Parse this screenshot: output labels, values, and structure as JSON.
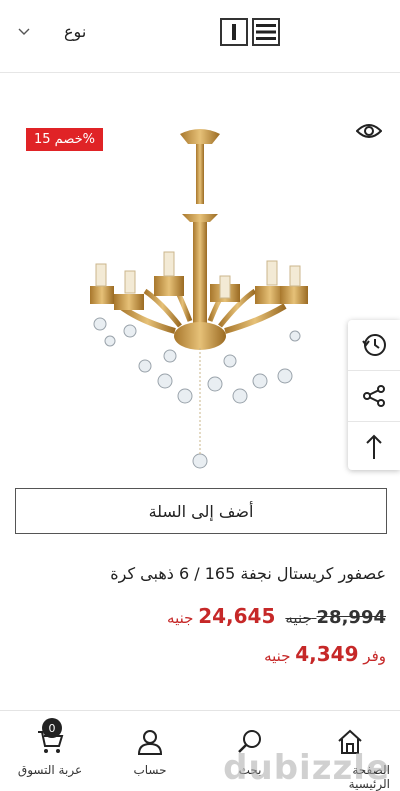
{
  "toolbar": {
    "sort_label": "نوع",
    "chevron_icon": "chevron-down-icon",
    "grid_icon": "grid-view-icon",
    "list_icon": "list-view-icon"
  },
  "product": {
    "discount_badge": "خصم 15%",
    "title": "عصفور كريستال نجفة 165 / 6 ذهبى كرة",
    "old_price_value": "28,994",
    "new_price_value": "24,645",
    "currency": "جنيه",
    "save_prefix": "وفر",
    "save_value": "4,349",
    "add_to_cart": "أضف إلى السلة"
  },
  "side_tools": [
    "history-icon",
    "share-icon",
    "arrow-up-icon"
  ],
  "bottom_nav": {
    "items": [
      {
        "label": "عربة التسوق",
        "icon": "cart-icon",
        "badge": "0"
      },
      {
        "label": "حساب",
        "icon": "user-icon"
      },
      {
        "label": "بحث",
        "icon": "search-icon"
      },
      {
        "label": "الصفحة الرئيسية",
        "icon": "home-icon"
      }
    ]
  },
  "watermark": "dubizzle",
  "colors": {
    "badge": "#e02326",
    "price_red": "#c62828"
  }
}
